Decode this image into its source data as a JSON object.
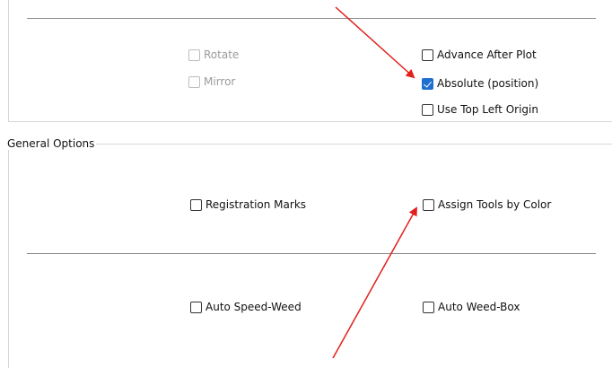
{
  "upper_section": {
    "options": {
      "rotate": {
        "label": "Rotate",
        "checked": false,
        "enabled": false
      },
      "mirror": {
        "label": "Mirror",
        "checked": false,
        "enabled": false
      },
      "advance_after_plot": {
        "label": "Advance After Plot",
        "checked": false,
        "enabled": true
      },
      "absolute_position": {
        "label": "Absolute (position)",
        "checked": true,
        "enabled": true
      },
      "use_top_left_origin": {
        "label": "Use Top Left Origin",
        "checked": false,
        "enabled": true
      }
    }
  },
  "general_options": {
    "title": "General Options",
    "options": {
      "registration_marks": {
        "label": "Registration Marks",
        "checked": false
      },
      "assign_tools_by_color": {
        "label": "Assign Tools by Color",
        "checked": false
      },
      "auto_speed_weed": {
        "label": "Auto Speed-Weed",
        "checked": false
      },
      "auto_weed_box": {
        "label": "Auto Weed-Box",
        "checked": false
      }
    }
  },
  "colors": {
    "checkbox_checked": "#1f6fd1",
    "annotation_arrow": "#e0201b",
    "separator": "#8a8a8a",
    "group_border": "#d7d7d7"
  }
}
